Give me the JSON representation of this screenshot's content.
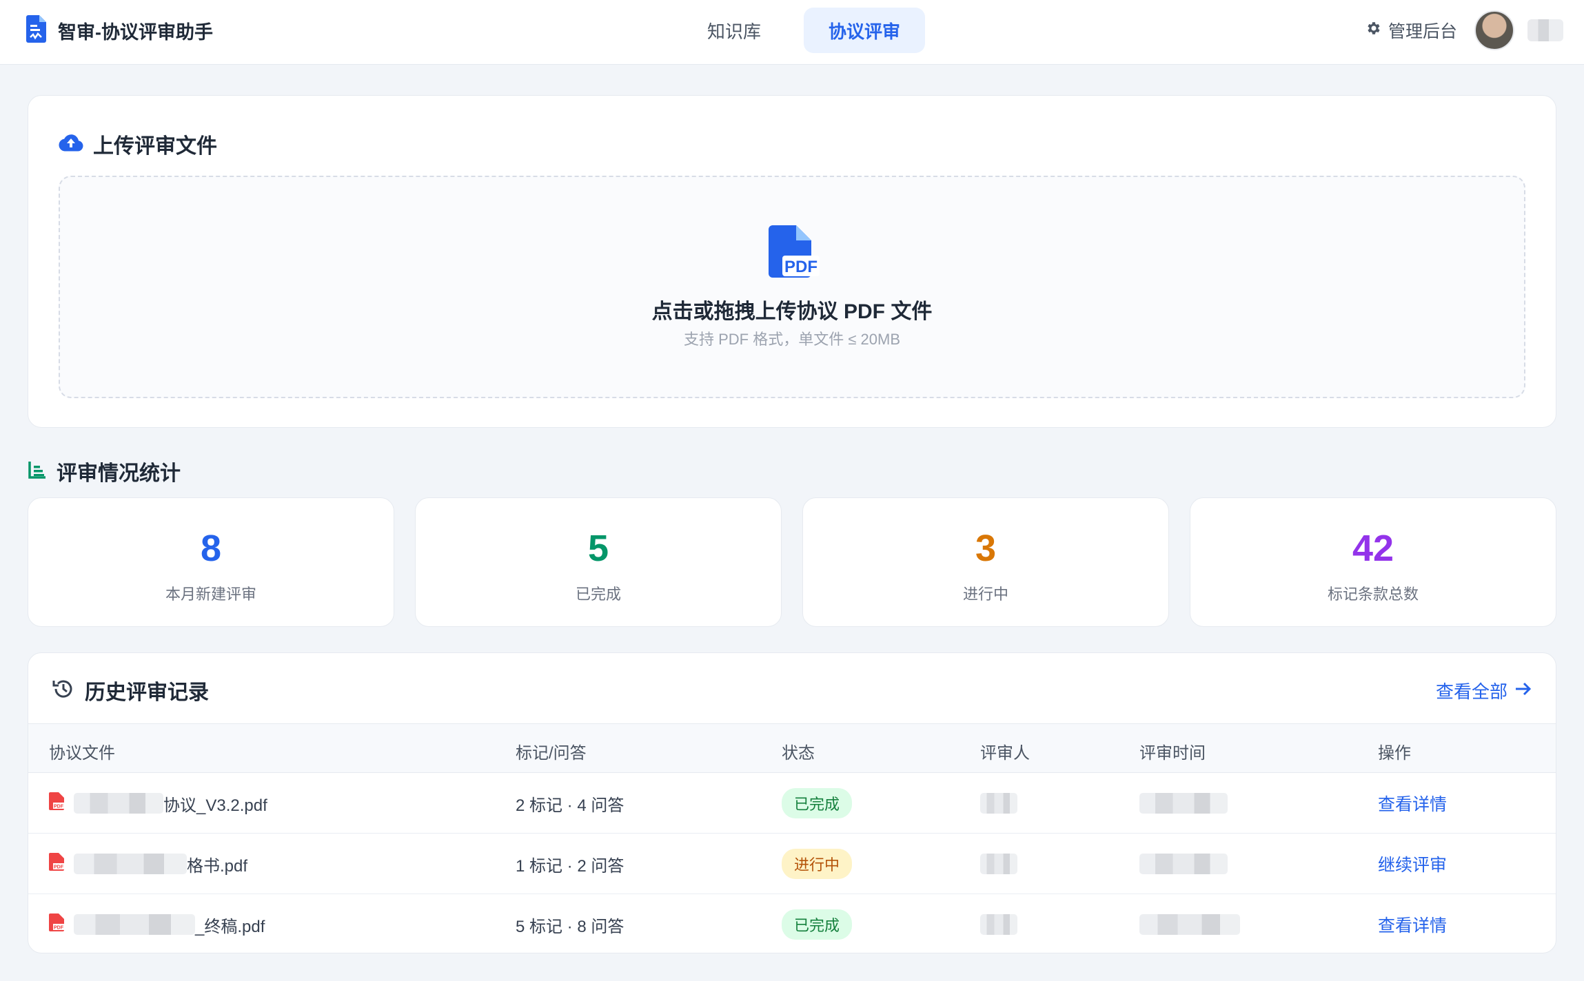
{
  "header": {
    "app_title": "智审-协议评审助手",
    "tabs": [
      {
        "label": "知识库",
        "active": false
      },
      {
        "label": "协议评审",
        "active": true
      }
    ],
    "admin_label": "管理后台"
  },
  "upload": {
    "title": "上传评审文件",
    "drop_title": "点击或拖拽上传协议 PDF 文件",
    "drop_hint": "支持 PDF 格式，单文件 ≤ 20MB",
    "icon_text": "PDF"
  },
  "stats": {
    "title": "评审情况统计",
    "items": [
      {
        "value": "8",
        "label": "本月新建评审",
        "color": "#2563eb"
      },
      {
        "value": "5",
        "label": "已完成",
        "color": "#059669"
      },
      {
        "value": "3",
        "label": "进行中",
        "color": "#d97706"
      },
      {
        "value": "42",
        "label": "标记条款总数",
        "color": "#9333ea"
      }
    ]
  },
  "history": {
    "title": "历史评审记录",
    "view_all": "查看全部",
    "columns": [
      "协议文件",
      "标记/问答",
      "状态",
      "评审人",
      "评审时间",
      "操作"
    ],
    "rows": [
      {
        "file_suffix": "协议_V3.2.pdf",
        "marks": "2 标记 · 4 问答",
        "status": "已完成",
        "status_type": "done",
        "action": "查看详情"
      },
      {
        "file_suffix": "格书.pdf",
        "marks": "1 标记 · 2 问答",
        "status": "进行中",
        "status_type": "progress",
        "action": "继续评审"
      },
      {
        "file_suffix": "_终稿.pdf",
        "marks": "5 标记 · 8 问答",
        "status": "已完成",
        "status_type": "done",
        "action": "查看详情"
      }
    ]
  },
  "colors": {
    "accent": "#2563eb",
    "pdf_red": "#ef4444",
    "stats_icon": "#059669"
  }
}
